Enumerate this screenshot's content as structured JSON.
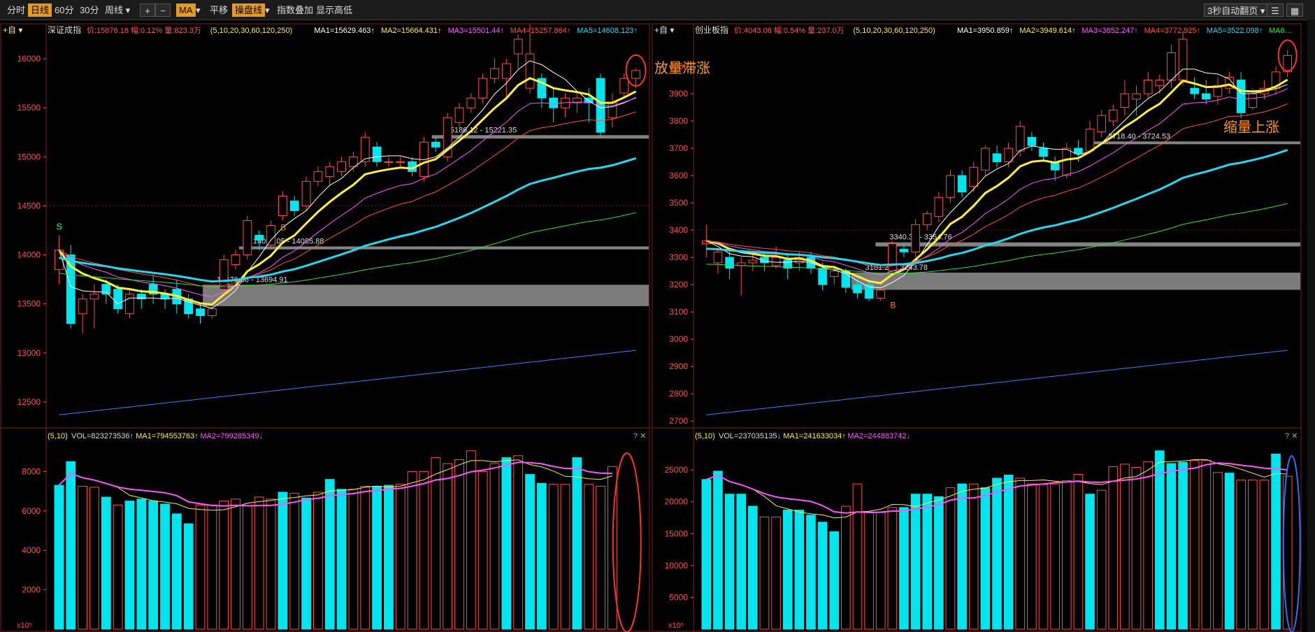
{
  "toolbar": {
    "items": [
      "分时",
      "日线",
      "60分",
      "30分",
      "周线 ▾"
    ],
    "selected": "日线",
    "plus": "+",
    "minus": "−",
    "ma": "MA",
    "pan": "平移",
    "mainchart": "操盘线",
    "overlay": "指数叠加",
    "showhl": "显示高低",
    "autopage": "3秒自动翻页 ▾"
  },
  "colors": {
    "up": "#ff4a4a",
    "down": "#00e5ee",
    "ma1": "#ffffff",
    "ma2": "#ffef3a",
    "ma3": "#ff55ff",
    "ma4": "#ff5030",
    "ma5": "#22d8ee",
    "ma6": "#33dd33",
    "ma7": "#3a7cff",
    "accent": "#e89a1c"
  },
  "charts": [
    {
      "name": "深证成指",
      "price_label": "价:15876.16 幅:0.12% 量:823.3万",
      "ma_params": "(5,10,20,30,60,120,250)",
      "ma_values": [
        "MA1=15629.463↑",
        "MA2=15664.431↑",
        "MA3=15501.44↑",
        "MA4=15257.864↑",
        "MA5=14608.123↑"
      ],
      "vol_header": "(5,10)",
      "vol_values": [
        "VOL=823273536↑",
        "MA1=794553763↑",
        "MA2=799285349↓"
      ],
      "vol_unit": "x10⁵",
      "zones": [
        {
          "label": "15186.12 - 15221.35"
        },
        {
          "label": "14056.05 - 14085.88"
        },
        {
          "label": "13476.66 - 13694.91"
        }
      ],
      "annotations": []
    },
    {
      "name": "创业板指",
      "price_label": "价:4043.06 幅:0.54% 量:237.0万",
      "ma_params": "(5,10,20,30,60,120,250)",
      "ma_values": [
        "MA1=3950.859↑",
        "MA2=3949.614↑",
        "MA3=3852.247↑",
        "MA4=3772.925↑",
        "MA5=3522.098↑",
        "MA6…"
      ],
      "vol_header": "(5,10)",
      "vol_values": [
        "VOL=237035135↓",
        "MA1=241633034↑",
        "MA2=244883742↓"
      ],
      "vol_unit": "x10⁵",
      "zones": [
        {
          "label": "3718.40 - 3724.53"
        },
        {
          "label": "3340.30 - 3354.76"
        },
        {
          "label": "3181.20 - 3243.78"
        }
      ],
      "annotations": [
        "放量滞涨",
        "缩量上涨"
      ]
    }
  ],
  "chart_data": [
    {
      "type": "candlestick",
      "title": "深证成指",
      "y_ticks": [
        12500,
        13000,
        13500,
        14000,
        14500,
        15000,
        15500,
        16000
      ],
      "ylim": [
        12250,
        16200
      ],
      "candles": [
        [
          13850,
          14050,
          13700,
          14200
        ],
        [
          14000,
          13300,
          13250,
          14100
        ],
        [
          13400,
          13550,
          13200,
          13600
        ],
        [
          13550,
          13600,
          13250,
          13700
        ],
        [
          13700,
          13600,
          13500,
          13750
        ],
        [
          13650,
          13450,
          13400,
          13700
        ],
        [
          13400,
          13600,
          13350,
          13650
        ],
        [
          13600,
          13550,
          13450,
          13650
        ],
        [
          13700,
          13600,
          13500,
          13800
        ],
        [
          13600,
          13550,
          13450,
          13650
        ],
        [
          13650,
          13500,
          13400,
          13750
        ],
        [
          13550,
          13400,
          13350,
          13600
        ],
        [
          13450,
          13380,
          13300,
          13500
        ],
        [
          13380,
          13450,
          13350,
          13500
        ],
        [
          13650,
          13950,
          13550,
          14000
        ],
        [
          13900,
          14000,
          13850,
          14050
        ],
        [
          14000,
          14350,
          13950,
          14400
        ],
        [
          14200,
          14150,
          14050,
          14250
        ],
        [
          14100,
          14300,
          14050,
          14350
        ],
        [
          14400,
          14600,
          14350,
          14650
        ],
        [
          14550,
          14450,
          14400,
          14600
        ],
        [
          14500,
          14750,
          14450,
          14800
        ],
        [
          14750,
          14850,
          14700,
          14900
        ],
        [
          14800,
          14900,
          14700,
          14950
        ],
        [
          14850,
          14950,
          14800,
          15000
        ],
        [
          14900,
          15000,
          14850,
          15050
        ],
        [
          14950,
          15200,
          14900,
          15250
        ],
        [
          15100,
          14950,
          14900,
          15150
        ],
        [
          14950,
          14950,
          14900,
          15000
        ],
        [
          14950,
          14950,
          14900,
          15000
        ],
        [
          14950,
          14850,
          14800,
          15000
        ],
        [
          14800,
          15150,
          14750,
          15200
        ],
        [
          15150,
          15100,
          15050,
          15200
        ],
        [
          15000,
          15400,
          14950,
          15450
        ],
        [
          15350,
          15500,
          15300,
          15550
        ],
        [
          15500,
          15600,
          15450,
          15650
        ],
        [
          15600,
          15800,
          15550,
          15850
        ],
        [
          15800,
          15900,
          15750,
          16000
        ],
        [
          15800,
          15950,
          15600,
          16000
        ],
        [
          16050,
          16200,
          15900,
          16250
        ],
        [
          15700,
          16050,
          15650,
          16350
        ],
        [
          15800,
          15600,
          15500,
          15850
        ],
        [
          15600,
          15500,
          15350,
          15700
        ],
        [
          15500,
          15600,
          15400,
          15650
        ],
        [
          15550,
          15600,
          15450,
          15650
        ],
        [
          15600,
          15550,
          15350,
          15700
        ],
        [
          15800,
          15250,
          15200,
          15850
        ],
        [
          15400,
          15550,
          15300,
          15650
        ],
        [
          15650,
          15800,
          15600,
          15850
        ],
        [
          15800,
          15880,
          15700,
          15900
        ]
      ],
      "volume_ticks": [
        2000,
        4000,
        6000,
        8000
      ],
      "volume": [
        7300,
        8500,
        7250,
        7200,
        6700,
        6300,
        6500,
        6600,
        6500,
        6350,
        5850,
        5350,
        6300,
        6300,
        6500,
        6600,
        6250,
        6700,
        6600,
        6950,
        6900,
        6650,
        6950,
        7600,
        7100,
        7100,
        7250,
        7250,
        7300,
        7350,
        8000,
        8000,
        8700,
        8400,
        8600,
        9050,
        8000,
        8400,
        8700,
        8800,
        7850,
        7400,
        7350,
        7350,
        8700,
        7350,
        7250,
        8250
      ],
      "volume_up": [
        false,
        false,
        true,
        true,
        false,
        true,
        false,
        false,
        false,
        false,
        false,
        false,
        true,
        true,
        true,
        true,
        true,
        true,
        true,
        false,
        true,
        false,
        true,
        false,
        false,
        true,
        true,
        false,
        false,
        true,
        true,
        true,
        true,
        true,
        true,
        true,
        true,
        true,
        false,
        true,
        false,
        false,
        true,
        true,
        false,
        true,
        true,
        true
      ]
    },
    {
      "type": "candlestick",
      "title": "创业板指",
      "y_ticks": [
        2700,
        2800,
        2900,
        3000,
        3100,
        3200,
        3300,
        3400,
        3500,
        3600,
        3700,
        3800,
        3900,
        4000
      ],
      "ylim": [
        2680,
        4100
      ],
      "candles": [
        [
          3350,
          3360,
          3300,
          3420
        ],
        [
          3280,
          3320,
          3240,
          3330
        ],
        [
          3300,
          3260,
          3220,
          3330
        ],
        [
          3270,
          3280,
          3160,
          3300
        ],
        [
          3280,
          3290,
          3250,
          3310
        ],
        [
          3300,
          3280,
          3250,
          3320
        ],
        [
          3270,
          3300,
          3260,
          3340
        ],
        [
          3290,
          3260,
          3220,
          3310
        ],
        [
          3280,
          3300,
          3250,
          3320
        ],
        [
          3300,
          3260,
          3240,
          3320
        ],
        [
          3260,
          3200,
          3180,
          3280
        ],
        [
          3230,
          3250,
          3200,
          3270
        ],
        [
          3250,
          3190,
          3170,
          3260
        ],
        [
          3200,
          3170,
          3150,
          3220
        ],
        [
          3200,
          3150,
          3140,
          3210
        ],
        [
          3150,
          3180,
          3140,
          3200
        ],
        [
          3250,
          3350,
          3240,
          3360
        ],
        [
          3330,
          3320,
          3300,
          3350
        ],
        [
          3320,
          3420,
          3300,
          3440
        ],
        [
          3420,
          3460,
          3400,
          3470
        ],
        [
          3450,
          3520,
          3430,
          3540
        ],
        [
          3520,
          3600,
          3500,
          3620
        ],
        [
          3600,
          3540,
          3520,
          3620
        ],
        [
          3560,
          3630,
          3540,
          3650
        ],
        [
          3620,
          3700,
          3600,
          3710
        ],
        [
          3680,
          3650,
          3630,
          3710
        ],
        [
          3650,
          3700,
          3630,
          3720
        ],
        [
          3690,
          3780,
          3670,
          3800
        ],
        [
          3740,
          3710,
          3690,
          3760
        ],
        [
          3700,
          3670,
          3650,
          3720
        ],
        [
          3650,
          3620,
          3580,
          3670
        ],
        [
          3600,
          3700,
          3590,
          3720
        ],
        [
          3700,
          3680,
          3650,
          3730
        ],
        [
          3690,
          3770,
          3680,
          3800
        ],
        [
          3760,
          3820,
          3740,
          3840
        ],
        [
          3800,
          3840,
          3780,
          3860
        ],
        [
          3850,
          3900,
          3820,
          3950
        ],
        [
          3880,
          3900,
          3820,
          3930
        ],
        [
          3900,
          3950,
          3880,
          3980
        ],
        [
          3930,
          3950,
          3900,
          3970
        ],
        [
          3950,
          4050,
          3920,
          4080
        ],
        [
          3950,
          4100,
          3930,
          4130
        ],
        [
          3920,
          3900,
          3880,
          3960
        ],
        [
          3900,
          3880,
          3860,
          3950
        ],
        [
          3890,
          3930,
          3860,
          3960
        ],
        [
          3920,
          3960,
          3900,
          3980
        ],
        [
          3950,
          3830,
          3810,
          3980
        ],
        [
          3850,
          3900,
          3840,
          3920
        ],
        [
          3900,
          3920,
          3880,
          3950
        ],
        [
          3920,
          3980,
          3900,
          4000
        ],
        [
          3980,
          4040,
          3960,
          4060
        ]
      ],
      "volume_ticks": [
        5000,
        10000,
        15000,
        20000,
        25000
      ],
      "volume": [
        23500,
        24800,
        21200,
        21200,
        19300,
        17600,
        17600,
        18700,
        18700,
        17900,
        16800,
        15300,
        19300,
        22800,
        18400,
        18300,
        19100,
        19100,
        21200,
        21200,
        20800,
        22200,
        22800,
        22800,
        22200,
        23700,
        24200,
        23700,
        22800,
        22700,
        22800,
        23300,
        24300,
        21200,
        21800,
        25500,
        25900,
        25400,
        26300,
        28000,
        26000,
        26200,
        26500,
        26500,
        24600,
        24500,
        23400,
        23400,
        23400,
        27500,
        24000
      ],
      "volume_up": [
        false,
        false,
        false,
        false,
        false,
        true,
        true,
        false,
        false,
        false,
        false,
        false,
        true,
        true,
        true,
        true,
        true,
        false,
        false,
        false,
        false,
        true,
        false,
        true,
        false,
        false,
        false,
        true,
        true,
        true,
        true,
        true,
        true,
        false,
        true,
        true,
        true,
        true,
        true,
        false,
        false,
        false,
        true,
        true,
        true,
        false,
        true,
        true,
        true,
        false,
        true
      ]
    }
  ]
}
